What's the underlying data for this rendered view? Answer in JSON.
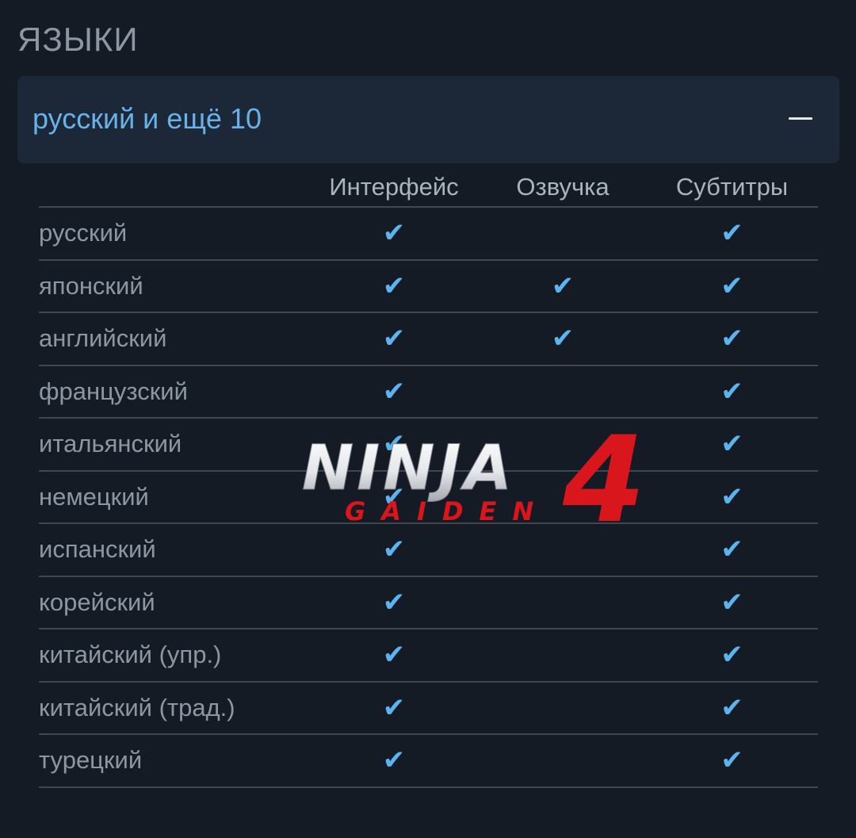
{
  "section_title": "ЯЗЫКИ",
  "summary": {
    "label": "русский и ещё 10"
  },
  "columns": {
    "interface": "Интерфейс",
    "audio": "Озвучка",
    "subtitles": "Субтитры"
  },
  "rows": [
    {
      "name": "русский",
      "interface": true,
      "audio": false,
      "subtitles": true
    },
    {
      "name": "японский",
      "interface": true,
      "audio": true,
      "subtitles": true
    },
    {
      "name": "английский",
      "interface": true,
      "audio": true,
      "subtitles": true
    },
    {
      "name": "французский",
      "interface": true,
      "audio": false,
      "subtitles": true
    },
    {
      "name": "итальянский",
      "interface": true,
      "audio": false,
      "subtitles": true
    },
    {
      "name": "немецкий",
      "interface": true,
      "audio": false,
      "subtitles": true
    },
    {
      "name": "испанский",
      "interface": true,
      "audio": false,
      "subtitles": true
    },
    {
      "name": "корейский",
      "interface": true,
      "audio": false,
      "subtitles": true
    },
    {
      "name": "китайский (упр.)",
      "interface": true,
      "audio": false,
      "subtitles": true
    },
    {
      "name": "китайский (трад.)",
      "interface": true,
      "audio": false,
      "subtitles": true
    },
    {
      "name": "турецкий",
      "interface": true,
      "audio": false,
      "subtitles": true
    }
  ],
  "check_glyph": "✔",
  "logo": {
    "word": "NINJA",
    "sub": "GAIDEN",
    "number": "4"
  },
  "colors": {
    "background": "#151b25",
    "summary_bg": "#1c2838",
    "accent": "#67b2e8",
    "check": "#5bb4f0",
    "logo_red": "#d8161b"
  }
}
